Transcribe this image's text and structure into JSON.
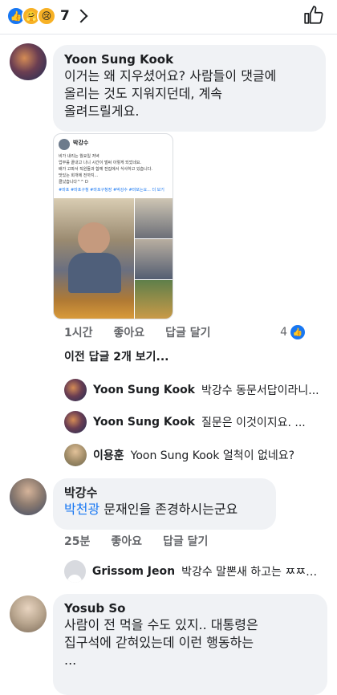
{
  "top": {
    "reaction_count": "7",
    "reaction_icons": [
      "like-icon",
      "care-icon",
      "sad-icon"
    ]
  },
  "comments": [
    {
      "author": "Yoon Sung Kook",
      "text_lines": [
        "이거는 왜 지우셨어요? 사람들이 댓글에",
        "올리는 것도 지워지던데, 계속",
        "올려드릴게요."
      ],
      "time": "1시간",
      "like_label": "좋아요",
      "reply_label": "답글 달기",
      "reaction_count": "4",
      "more_replies": "이전 답글 2개 보기...",
      "attachment": {
        "author": "박강수",
        "lines": [
          "비가 내리는 월요일 저녁",
          "업무를 끝내고 나니 시간이 벌써 이렇게 되었네요.",
          "배가 고파서 직원들과 함께 전집에서 식사하고 있습니다.",
          "맛있는 회개에 전까지...",
          "클났습니다^^ D"
        ],
        "tags": "#마포 #마포구청 #마포구청장 #박강수 #마포는요... 더 보기"
      }
    }
  ],
  "replies": [
    {
      "author": "Yoon Sung Kook",
      "text": "박강수 동문서답이라니..."
    },
    {
      "author": "Yoon Sung Kook",
      "text": "질문은 이것이지요. ..."
    },
    {
      "author": "이용훈",
      "text": "Yoon Sung Kook 얼척이 없네요?"
    }
  ],
  "comment2": {
    "author": "박강수",
    "mention": "박천광",
    "text": " 문재인을 존경하시는군요",
    "time": "25분",
    "like_label": "좋아요",
    "reply_label": "답글 달기"
  },
  "reply4": {
    "author": "Grissom Jeon",
    "text": "박강수 말뽄새 하고는 ㅉㅉㅉ..."
  },
  "comment3": {
    "author": "Yosub So",
    "text_lines": [
      "사람이 전 먹을 수도 있지..  대통령은",
      "집구석에 갇혀있는데 이런 행동하는",
      "..."
    ]
  }
}
